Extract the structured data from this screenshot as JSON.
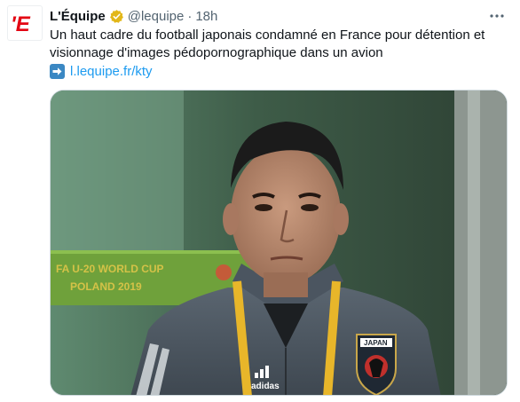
{
  "tweet": {
    "author_name": "L'Équipe",
    "handle": "@lequipe",
    "separator": "·",
    "time": "18h",
    "text": "Un haut cadre du football japonais condamné en France pour détention et visionnage d'images pédopornographique dans un avion",
    "link_text": "l.lequipe.fr/kty",
    "avatar_letters": "'E",
    "icons": {
      "verified": "verified-badge-icon",
      "more": "more-options-icon",
      "link_arrow": "right-arrow-icon"
    }
  },
  "media": {
    "banner_line1": "FA U-20 WORLD CUP",
    "banner_line2": "POLAND 2019",
    "crest_text": "JAPAN",
    "jacket_brand": "adidas"
  },
  "colors": {
    "brand_red": "#e30613",
    "verified_gold": "#e2b719",
    "link_blue": "#1d9bf0",
    "secondary_text": "#536471"
  }
}
